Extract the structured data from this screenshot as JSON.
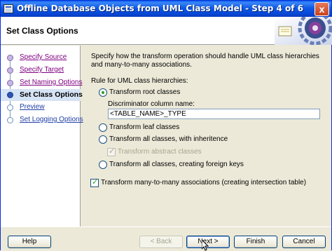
{
  "window": {
    "title": "Offline Database Objects from UML Class Model - Step 4 of 6",
    "close_glyph": "x"
  },
  "header": {
    "title": "Set Class Options"
  },
  "nav": {
    "items": [
      {
        "label": "Specify Source",
        "state": "done"
      },
      {
        "label": "Specify Target",
        "state": "done"
      },
      {
        "label": "Set Naming Options",
        "state": "done"
      },
      {
        "label": "Set Class Options",
        "state": "current"
      },
      {
        "label": "Preview",
        "state": "todo"
      },
      {
        "label": "Set Logging Options",
        "state": "todo"
      }
    ]
  },
  "content": {
    "description": "Specify how the transform operation should handle UML class hierarchies and many-to-many associations.",
    "rule_label": "Rule for UML class hierarchies:",
    "options": {
      "root": {
        "label": "Transform root classes",
        "selected": true
      },
      "discriminator_label": "Discriminator column name:",
      "discriminator_value": "<TABLE_NAME>_TYPE",
      "leaf": {
        "label": "Transform leaf classes",
        "selected": false
      },
      "inheritance": {
        "label": "Transform all classes, with inheritence",
        "selected": false
      },
      "abstract": {
        "label": "Transform abstract classes",
        "checked": true,
        "disabled": true
      },
      "foreign_keys": {
        "label": "Transform all classes, creating foreign keys",
        "selected": false
      },
      "many_to_many": {
        "label": "Transform many-to-many associations (creating intersection table)",
        "checked": true
      }
    }
  },
  "footer": {
    "help": "Help",
    "back": "< Back",
    "next": "Next >",
    "finish": "Finish",
    "cancel": "Cancel"
  },
  "colors": {
    "title_bar": "#0a5cf0",
    "current_step_bg": "#d6e3f5",
    "visited_link": "#800080",
    "link": "#1f3ea6"
  }
}
